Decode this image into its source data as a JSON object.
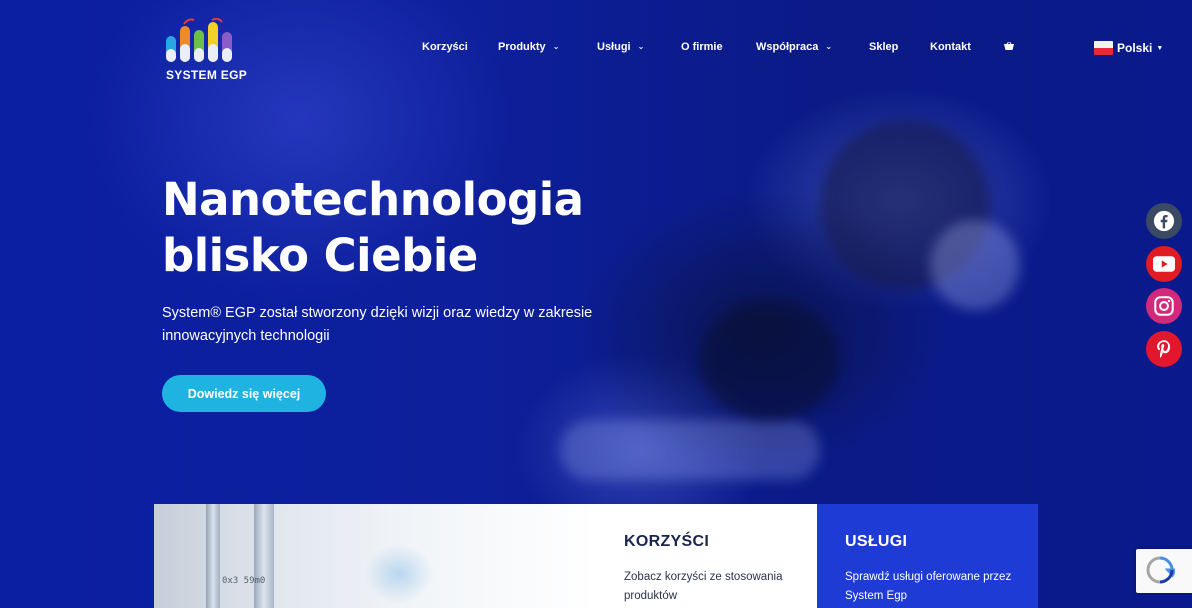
{
  "brand": {
    "logo_text": "SYSTEM EGP",
    "colors": {
      "blue": "#1e3bd6",
      "cyan": "#1fb3e2",
      "green": "#6cc04a",
      "purple": "#8a5cc7",
      "orange": "#f08a24"
    }
  },
  "nav": {
    "items": [
      {
        "label": "Korzyści",
        "dropdown": false
      },
      {
        "label": "Produkty",
        "dropdown": true
      },
      {
        "label": "Usługi",
        "dropdown": true
      },
      {
        "label": "O firmie",
        "dropdown": false
      },
      {
        "label": "Współpraca",
        "dropdown": true
      },
      {
        "label": "Sklep",
        "dropdown": false
      },
      {
        "label": "Kontakt",
        "dropdown": false
      }
    ],
    "cart_icon": "basket-icon",
    "language": {
      "label": "Polski",
      "flag": "pl-flag-icon"
    }
  },
  "hero": {
    "title_line1": "Nanotechnologia",
    "title_line2": "blisko Ciebie",
    "subtitle": "System® EGP został stworzony dzięki wizji oraz wiedzy w zakresie innowacyjnych technologii",
    "cta_label": "Dowiedz się więcej"
  },
  "social": [
    {
      "name": "facebook",
      "icon": "facebook-icon",
      "color": "#3b4a63"
    },
    {
      "name": "youtube",
      "icon": "youtube-icon",
      "color": "#e01b22"
    },
    {
      "name": "instagram",
      "icon": "instagram-icon",
      "color": "#d3297c"
    },
    {
      "name": "pinterest",
      "icon": "pinterest-icon",
      "color": "#e2162c"
    }
  ],
  "cards": [
    {
      "title": "KORZYŚCI",
      "text": "Zobacz korzyści ze stosowania produktów",
      "bg": "#ffffff"
    },
    {
      "title": "USŁUGI",
      "text": "Sprawdź usługi oferowane przez System Egp",
      "bg": "#1e3bd6"
    }
  ],
  "photo_label": "0x3 59m0"
}
